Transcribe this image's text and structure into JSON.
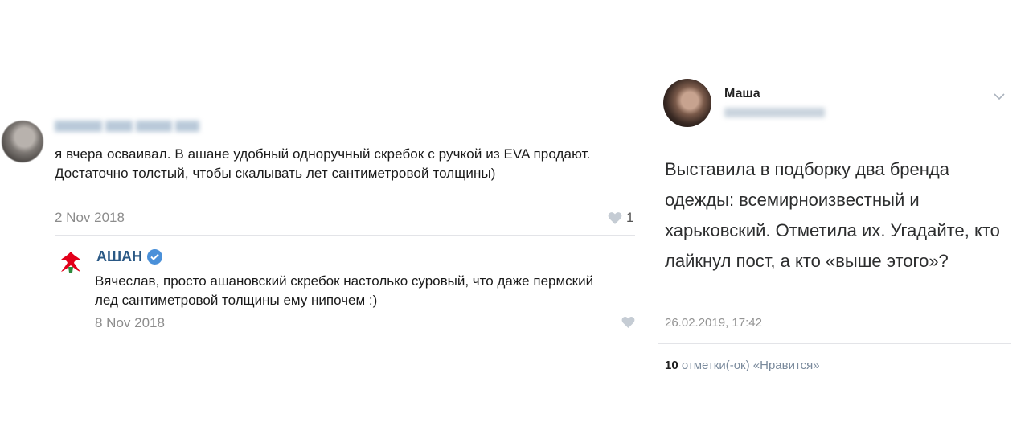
{
  "comment": {
    "text": "я вчера осваивал. В ашане удобный одноручный скребок с ручкой из EVA продают. Достаточно толстый, чтобы скалывать лет сантиметровой толщины)",
    "date": "2 Nov 2018",
    "likes": "1"
  },
  "reply": {
    "author": "АШАН",
    "text": "Вячеслав, просто ашановский скребок настолько суровый, что даже пермский лед сантиметровой толщины ему нипочем :)",
    "date": "8 Nov 2018"
  },
  "post": {
    "author": "Маша",
    "text": "Выставила в подборку два бренда одежды: всемирноизвестный и харьковский. Отметила их. Угадайте, кто лайкнул пост, а кто «выше этого»?",
    "date": "26.02.2019, 17:42",
    "likes_count": "10",
    "likes_label": "отметки(-ок) «Нравится»"
  },
  "icons": {
    "heart": "heart-icon",
    "verified": "verified-badge-icon",
    "chevron": "chevron-down-icon",
    "brand_logo": "auchan-logo"
  },
  "colors": {
    "link": "#2a5885",
    "meta": "#8c8c8c",
    "verified": "#4a90d9",
    "auchan_red": "#e2001a"
  }
}
